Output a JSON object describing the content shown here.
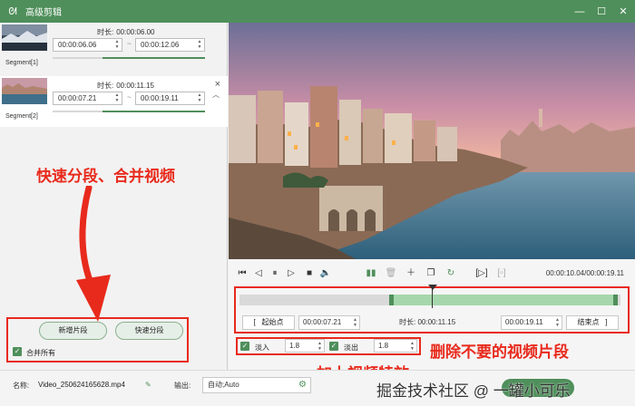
{
  "window": {
    "title": "高级剪辑",
    "app_icon": "rabbit-icon",
    "controls": [
      "minimize-icon",
      "maximize-icon",
      "close-icon"
    ]
  },
  "segments": [
    {
      "label": "Segment[1]",
      "duration_key": "时长:",
      "duration": "00:00:06.00",
      "start": "00:00:06.06",
      "end": "00:00:12.06",
      "separator": "~"
    },
    {
      "label": "Segment[2]",
      "duration_key": "时长:",
      "duration": "00:00:11.15",
      "start": "00:00:07.21",
      "end": "00:00:19.11",
      "separator": "~",
      "close": "×",
      "up": "︿"
    }
  ],
  "left_actions": {
    "add_segment": "新增片段",
    "quick_split": "快速分段",
    "merge_all": "合并所有"
  },
  "annotations": {
    "callout_split": "快速分段、合并视频",
    "callout_delete": "删除不要的视频片段",
    "callout_effect": "加上视频特效"
  },
  "player": {
    "timecode": "00:00:10.04/00:00:19.11"
  },
  "timeline": {
    "range": {
      "start_label": "起始点",
      "start_value": "00:00:07.21",
      "duration_key": "时长:",
      "duration_value": "00:00:11.15",
      "end_value": "00:00:19.11",
      "end_label": "结束点",
      "bracket_left": "[",
      "bracket_right": "]"
    }
  },
  "effects": {
    "fade_in_label": "淡入",
    "fade_in_value": "1.8",
    "fade_out_label": "淡出",
    "fade_out_value": "1.8"
  },
  "footer": {
    "name_label": "名称:",
    "name_value": "Video_250624165628.mp4",
    "output_label": "输出:",
    "output_value": "自动;Auto",
    "go_label": "Go",
    "watermark": "掘金技术社区 @ 一罐小可乐"
  },
  "colors": {
    "accent": "#4f8f5b",
    "annotation_red": "#e82a1c"
  }
}
